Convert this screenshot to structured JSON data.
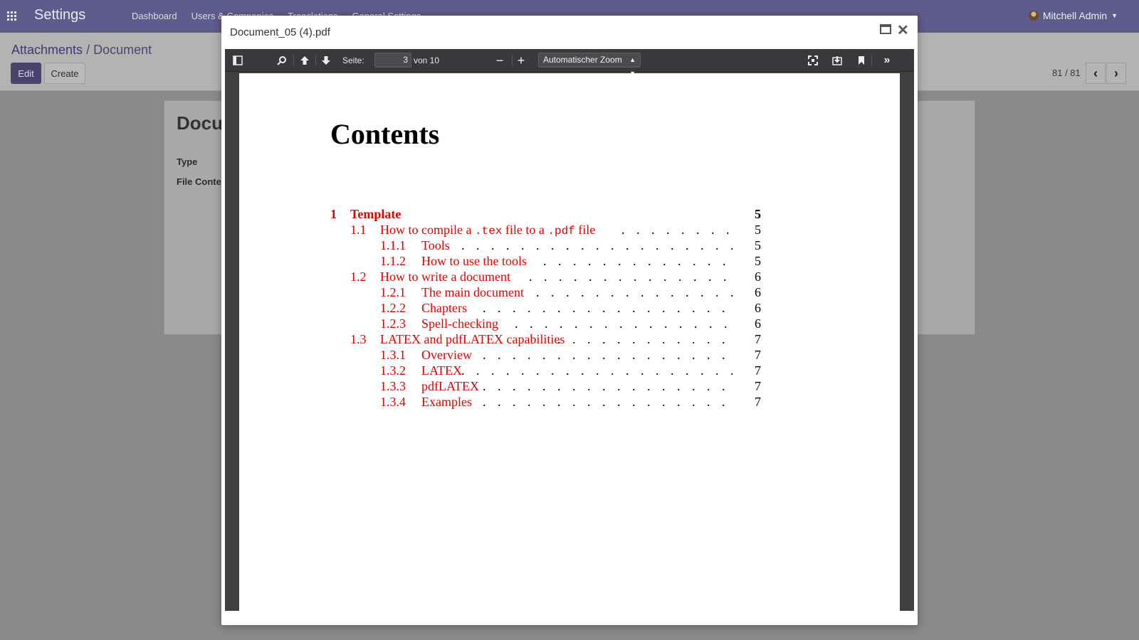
{
  "app": {
    "brand": "Settings",
    "menu": [
      "Dashboard",
      "Users & Companies",
      "Translations",
      "General Settings"
    ],
    "user": "Mitchell Admin"
  },
  "control_panel": {
    "breadcrumb_parent": "Attachments",
    "breadcrumb_sep": "/",
    "breadcrumb_current": "Document",
    "edit_label": "Edit",
    "create_label": "Create",
    "pager": "81 / 81"
  },
  "form": {
    "title": "Docu",
    "type_label": "Type",
    "file_label": "File Conte"
  },
  "modal": {
    "title": "Document_05 (4).pdf"
  },
  "pdf_toolbar": {
    "page_label": "Seite:",
    "page_value": "3",
    "page_total": "von 10",
    "zoom": "Automatischer Zoom"
  },
  "toc": {
    "heading": "Contents",
    "entries": [
      {
        "num": "1",
        "text": "Template",
        "page": "5",
        "level": 0
      },
      {
        "num": "1.1",
        "text": "How to compile a .tex file to a .pdf file",
        "page": "5",
        "level": 1
      },
      {
        "num": "1.1.1",
        "text": "Tools",
        "page": "5",
        "level": 2
      },
      {
        "num": "1.1.2",
        "text": "How to use the tools",
        "page": "5",
        "level": 2
      },
      {
        "num": "1.2",
        "text": "How to write a document",
        "page": "6",
        "level": 1
      },
      {
        "num": "1.2.1",
        "text": "The main document",
        "page": "6",
        "level": 2
      },
      {
        "num": "1.2.2",
        "text": "Chapters",
        "page": "6",
        "level": 2
      },
      {
        "num": "1.2.3",
        "text": "Spell-checking",
        "page": "6",
        "level": 2
      },
      {
        "num": "1.3",
        "text": "LATEX and pdfLATEX capabilities",
        "page": "7",
        "level": 1
      },
      {
        "num": "1.3.1",
        "text": "Overview",
        "page": "7",
        "level": 2
      },
      {
        "num": "1.3.2",
        "text": "LATEX",
        "page": "7",
        "level": 2
      },
      {
        "num": "1.3.3",
        "text": "pdfLATEX",
        "page": "7",
        "level": 2
      },
      {
        "num": "1.3.4",
        "text": "Examples",
        "page": "7",
        "level": 2
      }
    ]
  }
}
